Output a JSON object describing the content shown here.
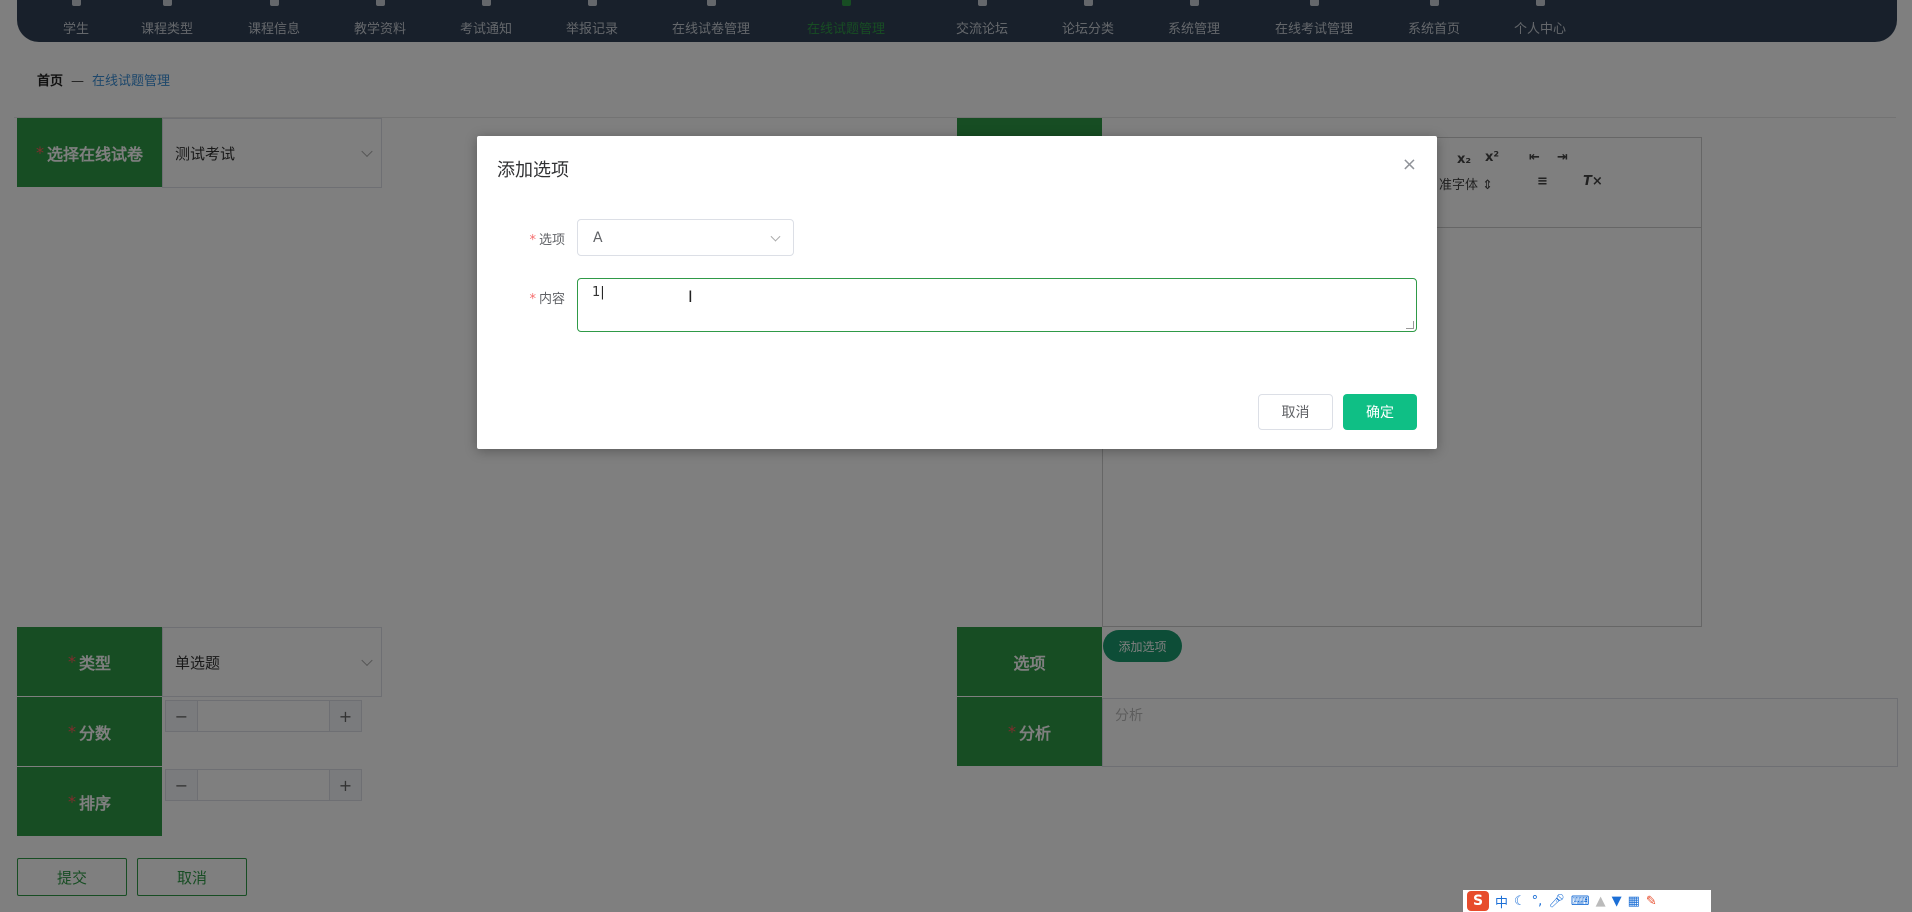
{
  "nav": {
    "items": [
      {
        "label": "学生"
      },
      {
        "label": "课程类型"
      },
      {
        "label": "课程信息"
      },
      {
        "label": "教学资料"
      },
      {
        "label": "考试通知"
      },
      {
        "label": "举报记录"
      },
      {
        "label": "在线试卷管理"
      },
      {
        "label": "在线试题管理",
        "active": true
      },
      {
        "label": "交流论坛"
      },
      {
        "label": "论坛分类"
      },
      {
        "label": "系统管理"
      },
      {
        "label": "在线考试管理"
      },
      {
        "label": "系统首页"
      },
      {
        "label": "个人中心"
      }
    ]
  },
  "breadcrumb": {
    "home": "首页",
    "separator": "—",
    "current": "在线试题管理"
  },
  "form": {
    "paper": {
      "label": "选择在线试卷",
      "required": "*",
      "value": "测试考试"
    },
    "type": {
      "label": "类型",
      "required": "*",
      "value": "单选题"
    },
    "score": {
      "label": "分数",
      "required": "*"
    },
    "order": {
      "label": "排序",
      "required": "*"
    },
    "options": {
      "label": "选项",
      "add_button": "添加选项"
    },
    "analysis": {
      "label": "分析",
      "required": "*",
      "placeholder": "分析"
    },
    "editor": {
      "font_label": "准字体"
    },
    "submit": "提交",
    "cancel": "取消"
  },
  "dialog": {
    "title": "添加选项",
    "close_icon": "×",
    "option_label": "选项",
    "option_value": "A",
    "content_label": "内容",
    "content_value": "1",
    "required": "*",
    "cancel": "取消",
    "confirm": "确定"
  },
  "ime": {
    "logo": "S",
    "mode": "中"
  },
  "colors": {
    "accent": "#2f9a47",
    "nav_bg": "#304156",
    "confirm": "#0fbf85",
    "required": "#f56c6c"
  }
}
